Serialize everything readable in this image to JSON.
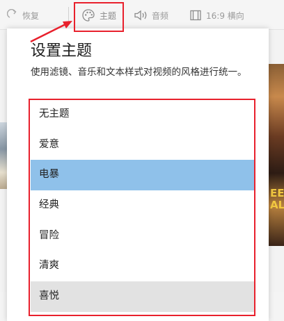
{
  "toolbar": {
    "undo_label": "恢复",
    "theme_label": "主题",
    "audio_label": "音频",
    "aspect_label": "16:9 横向"
  },
  "theme_panel": {
    "title": "设置主题",
    "description": "使用滤镜、音乐和文本样式对视频的风格进行统一。",
    "themes": [
      {
        "label": "无主题"
      },
      {
        "label": "爱意"
      },
      {
        "label": "电暴"
      },
      {
        "label": "经典"
      },
      {
        "label": "冒险"
      },
      {
        "label": "清爽"
      },
      {
        "label": "喜悦"
      }
    ],
    "selected_theme": "电暴",
    "hovered_theme": "喜悦"
  },
  "background": {
    "poster_text": "EE\nAL"
  },
  "colors": {
    "accent_selected": "#8fc1ea",
    "hover": "#e2e2e2",
    "annotation_red": "#e8202c"
  }
}
